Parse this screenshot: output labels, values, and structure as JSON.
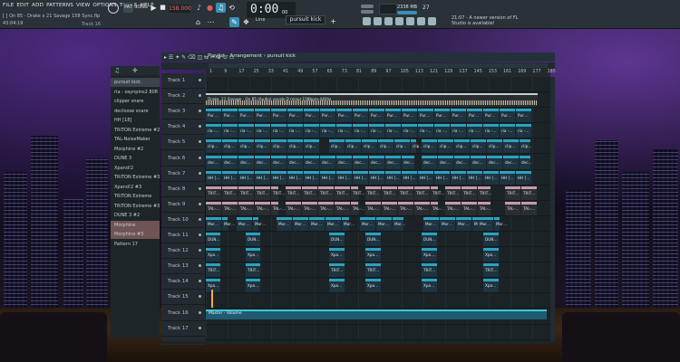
{
  "menu": [
    "FILE",
    "EDIT",
    "ADD",
    "PATTERNS",
    "VIEW",
    "OPTIONS",
    "TOOLS",
    "HELP"
  ],
  "hint_line": "[ ] On 85 - Drake x 21 Savage 158 Sync.flp",
  "clock": "43:04:19",
  "hover_hint": "Track 16",
  "tempo": "158.000",
  "time_main": "0:00",
  "time_sub": "00",
  "time_frac": "M:S:CS",
  "snap_label": "Line",
  "pattern_name": "pursuit kick",
  "memory": "2338 MB",
  "cpu_number": "27",
  "news": "21:07 - A newer version of FL Studio is available!",
  "playlist_title": "Playlist - Arrangement › pursuit kick",
  "ruler": [
    "1",
    "9",
    "17",
    "25",
    "33",
    "41",
    "49",
    "57",
    "65",
    "73",
    "81",
    "89",
    "97",
    "105",
    "113",
    "121",
    "129",
    "137",
    "145",
    "153",
    "161",
    "169",
    "177",
    "185"
  ],
  "browser_items": [
    {
      "label": "pursuit kick",
      "style": "sel"
    },
    {
      "label": "ria - zaynpins2 808",
      "style": ""
    },
    {
      "label": "clipper snare",
      "style": ""
    },
    {
      "label": "decloose snare",
      "style": ""
    },
    {
      "label": "HH [18]",
      "style": ""
    },
    {
      "label": "TRITON Extreme #2",
      "style": ""
    },
    {
      "label": "TAL-NoiseMaker",
      "style": ""
    },
    {
      "label": "Morphine #2",
      "style": ""
    },
    {
      "label": "DUNE 3",
      "style": ""
    },
    {
      "label": "Xpand!2",
      "style": ""
    },
    {
      "label": "TRITON Extreme #3",
      "style": ""
    },
    {
      "label": "Xpand!2 #3",
      "style": ""
    },
    {
      "label": "TRITON Extreme",
      "style": ""
    },
    {
      "label": "TRITON Extreme #3",
      "style": ""
    },
    {
      "label": "DUNE 3 #2",
      "style": ""
    },
    {
      "label": "Morphine",
      "style": "hl"
    },
    {
      "label": "Morphine #3",
      "style": "hl"
    },
    {
      "label": "Pattern 17",
      "style": ""
    }
  ],
  "tracks": [
    "Track 1",
    "Track 2",
    "Track 3",
    "Track 4",
    "Track 5",
    "Track 6",
    "Track 7",
    "Track 8",
    "Track 9",
    "Track 10",
    "Track 11",
    "Track 12",
    "Track 13",
    "Track 14",
    "Track 15",
    "Track 16",
    "Track 17"
  ],
  "audio_clip_label": "Drake, 21 Savage - On 85 (Audio) vocals-D minor-158bpm-440hz",
  "clip_labels": {
    "t3": "Pur…",
    "t4": "ria -…",
    "t5": "clip…",
    "t6": "dec…",
    "t7": "HH […",
    "t8": "TRIT…",
    "t9": "TAL-…",
    "t10": "Mor…",
    "t11": "DUN…",
    "t12": "Xpa…",
    "t13": "TRIT…",
    "t14": "Xpa…"
  },
  "automation_label": "Master - Volume"
}
